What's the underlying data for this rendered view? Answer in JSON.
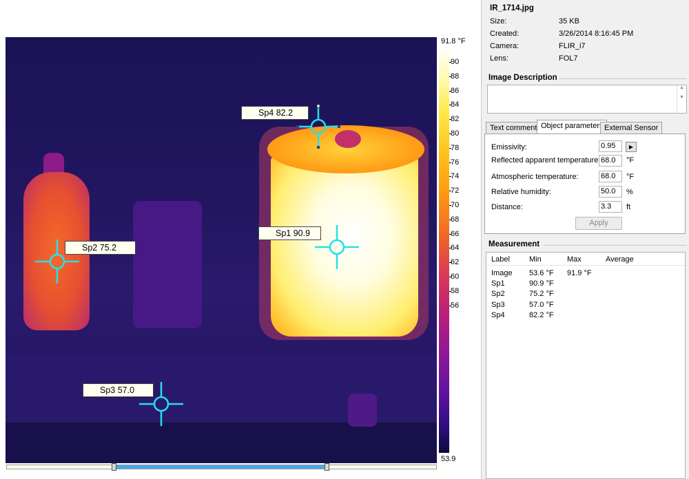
{
  "file": {
    "name": "IR_1714.jpg",
    "rows": [
      {
        "label": "Size:",
        "value": "35 KB"
      },
      {
        "label": "Created:",
        "value": "3/26/2014 8:16:45 PM"
      },
      {
        "label": "Camera:",
        "value": "FLIR_i7"
      },
      {
        "label": "Lens:",
        "value": "FOL7"
      }
    ]
  },
  "description": {
    "title": "Image Description",
    "text": ""
  },
  "tabs": [
    "Text comments",
    "Object parameters",
    "External Sensor"
  ],
  "active_tab": "Object parameters",
  "params": [
    {
      "label": "Emissivity:",
      "value": "0.95",
      "unit": ""
    },
    {
      "label": "Reflected apparent temperature:",
      "value": "68.0",
      "unit": "°F"
    },
    {
      "label": "Atmospheric temperature:",
      "value": "68.0",
      "unit": "°F"
    },
    {
      "label": "Relative humidity:",
      "value": "50.0",
      "unit": "%"
    },
    {
      "label": "Distance:",
      "value": "3.3",
      "unit": "ft"
    }
  ],
  "apply_label": "Apply",
  "measurement": {
    "title": "Measurement",
    "columns": [
      "Label",
      "Min",
      "Max",
      "Average"
    ],
    "rows": [
      {
        "label": "Image",
        "min": "53.6 °F",
        "max": "91.9 °F",
        "avg": ""
      },
      {
        "label": "Sp1",
        "min": "90.9 °F",
        "max": "",
        "avg": ""
      },
      {
        "label": "Sp2",
        "min": "75.2 °F",
        "max": "",
        "avg": ""
      },
      {
        "label": "Sp3",
        "min": "57.0 °F",
        "max": "",
        "avg": ""
      },
      {
        "label": "Sp4",
        "min": "82.2 °F",
        "max": "",
        "avg": ""
      }
    ]
  },
  "spots": [
    {
      "text": "Sp1 90.9"
    },
    {
      "text": "Sp2 75.2"
    },
    {
      "text": "Sp3 57.0"
    },
    {
      "text": "Sp4 82.2"
    }
  ],
  "scale": {
    "max_label": "91.8 °F",
    "min_label": "53.9",
    "ticks": [
      "90",
      "88",
      "86",
      "84",
      "82",
      "80",
      "78",
      "76",
      "74",
      "72",
      "70",
      "68",
      "66",
      "64",
      "62",
      "60",
      "58",
      "56"
    ]
  },
  "colors": {
    "crosshair": "#26e0e8",
    "selection": "#47a8e8"
  }
}
